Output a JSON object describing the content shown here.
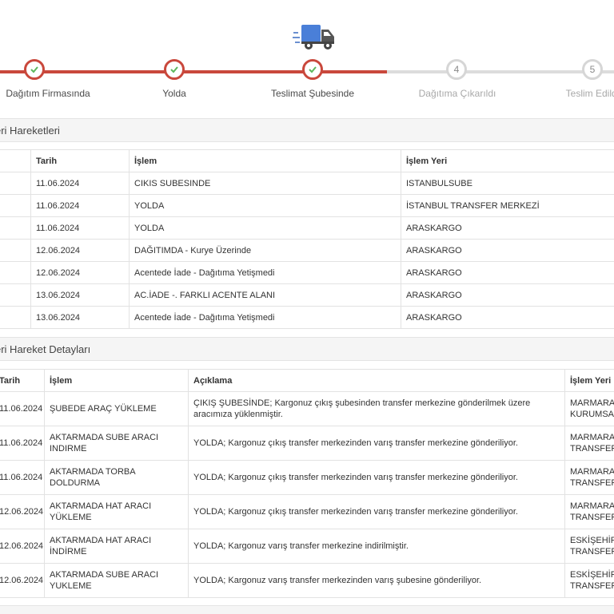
{
  "stepper": {
    "steps": [
      {
        "label": "Dağıtım Firmasında",
        "status": "done"
      },
      {
        "label": "Yolda",
        "status": "done"
      },
      {
        "label": "Teslimat Şubesinde",
        "status": "done"
      },
      {
        "label": "Dağıtıma Çıkarıldı",
        "status": "pending",
        "number": "4"
      },
      {
        "label": "Teslim Edildi",
        "status": "pending",
        "number": "5"
      }
    ]
  },
  "colors": {
    "accent": "#c9483c",
    "check": "#5cb85c",
    "truck": "#4a7fd8",
    "pending": "#dcdcdc"
  },
  "section1": {
    "title": "eri Hareketleri",
    "columns": [
      "",
      "Tarih",
      "İşlem",
      "İşlem Yeri"
    ],
    "rows": [
      {
        "date": "11.06.2024",
        "action": "CIKIS SUBESINDE",
        "place": "ISTANBULSUBE"
      },
      {
        "date": "11.06.2024",
        "action": "YOLDA",
        "place": "İSTANBUL TRANSFER MERKEZİ"
      },
      {
        "date": "11.06.2024",
        "action": "YOLDA",
        "place": "ARASKARGO"
      },
      {
        "date": "12.06.2024",
        "action": "DAĞITIMDA - Kurye Üzerinde",
        "place": "ARASKARGO"
      },
      {
        "date": "12.06.2024",
        "action": "Acentede İade - Dağıtıma Yetişmedi",
        "place": "ARASKARGO"
      },
      {
        "date": "13.06.2024",
        "action": "AC.İADE -. FARKLI ACENTE ALANI",
        "place": "ARASKARGO"
      },
      {
        "date": "13.06.2024",
        "action": "Acentede İade - Dağıtıma Yetişmedi",
        "place": "ARASKARGO"
      }
    ]
  },
  "section2": {
    "title": "eri Hareket Detayları",
    "columns": [
      "Tarih",
      "İşlem",
      "Açıklama",
      "İşlem Yeri"
    ],
    "rows": [
      {
        "date": "11.06.2024",
        "action": "ŞUBEDE ARAÇ YÜKLEME",
        "description": "ÇIKIŞ ŞUBESİNDE; Kargonuz çıkış şubesinden transfer merkezine gönderilmek üzere aracımıza yüklenmiştir.",
        "place": "MARMARA KURUMSAL"
      },
      {
        "date": "11.06.2024",
        "action": "AKTARMADA SUBE ARACI INDIRME",
        "description": "YOLDA; Kargonuz çıkış transfer merkezinden varış transfer merkezine gönderiliyor.",
        "place": "MARMARA TRANSFER"
      },
      {
        "date": "11.06.2024",
        "action": "AKTARMADA TORBA DOLDURMA",
        "description": "YOLDA; Kargonuz çıkış transfer merkezinden varış transfer merkezine gönderiliyor.",
        "place": "MARMARA TRANSFER"
      },
      {
        "date": "12.06.2024",
        "action": "AKTARMADA HAT ARACI YÜKLEME",
        "description": "YOLDA; Kargonuz çıkış transfer merkezinden varış transfer merkezine gönderiliyor.",
        "place": "MARMARA TRANSFER"
      },
      {
        "date": "12.06.2024",
        "action": "AKTARMADA HAT ARACI İNDİRME",
        "description": "YOLDA; Kargonuz varış transfer merkezine indirilmiştir.",
        "place": "ESKİŞEHİR TRANSFER"
      },
      {
        "date": "12.06.2024",
        "action": "AKTARMADA SUBE ARACI YUKLEME",
        "description": "YOLDA; Kargonuz varış transfer merkezinden varış şubesine gönderiliyor.",
        "place": "ESKİŞEHİR TRANSFER"
      }
    ]
  }
}
